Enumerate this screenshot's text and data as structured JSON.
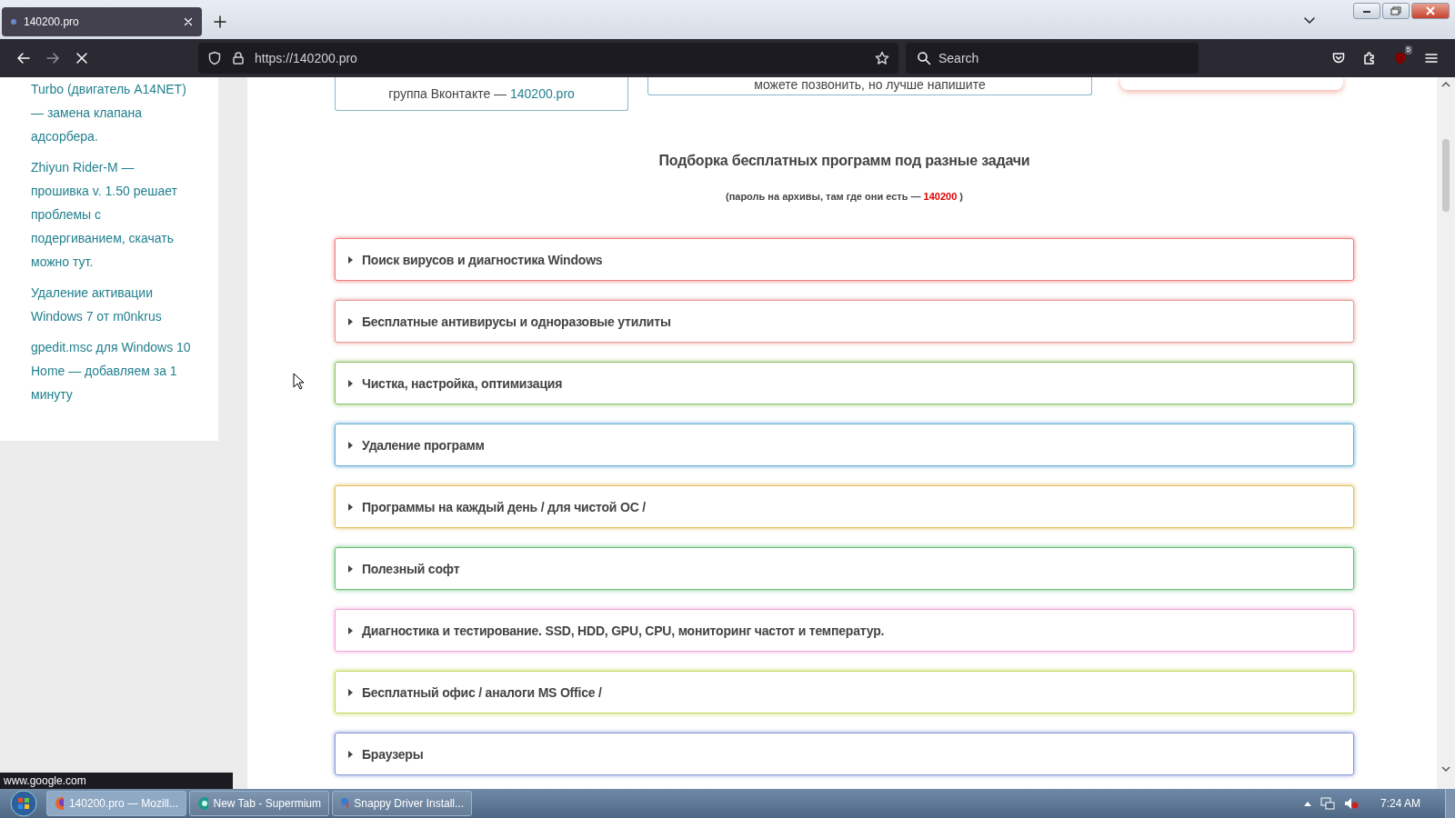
{
  "browser": {
    "tabs": [
      {
        "title": "140200.pro",
        "selected": true
      }
    ],
    "url": "https://140200.pro",
    "search_placeholder": "Search",
    "extensions_badge": "5"
  },
  "sidebar": {
    "links": [
      "Turbo (двигатель A14NET) — замена клапана адсорбера.",
      "Zhiyun Rider-M — прошивка v. 1.50 решает проблемы с подергиванием, скачать можно тут.",
      "Удаление активации Windows 7 от m0nkrus",
      "gpedit.msc для Windows 10 Home — добавляем за 1 минуту"
    ]
  },
  "cards": [
    {
      "text": "группа Вконтакте —",
      "link": "140200.pro"
    },
    {
      "text": "можете позвонить, но лучше напишите"
    }
  ],
  "heading": "Подборка бесплатных программ под разные задачи",
  "note": {
    "text": "(пароль на архивы, там где они есть —",
    "password": "140200",
    "closing": ")"
  },
  "sections": [
    {
      "title": "Поиск вирусов и диагностика Windows",
      "color": "#f08080",
      "expanded": false
    },
    {
      "title": "Бесплатные антивирусы и одноразовые утилиты",
      "color": "#e89a9a",
      "expanded": false
    },
    {
      "title": "Чистка, настройка, оптимизация",
      "color": "#8fc46a",
      "expanded": false
    },
    {
      "title": "Удаление программ",
      "color": "#6aaed6",
      "expanded": false
    },
    {
      "title": "Программы на каждый день / для чистой ОС /",
      "color": "#e0c060",
      "expanded": false
    },
    {
      "title": "Полезный софт",
      "color": "#6cc07a",
      "expanded": false
    },
    {
      "title": "Диагностика и тестирование. SSD, HDD, GPU, CPU, мониторинг частот и температур.",
      "color": "#f0a8d8",
      "expanded": false
    },
    {
      "title": "Бесплатный офис / аналоги MS Office /",
      "color": "#c8d860",
      "expanded": false
    },
    {
      "title": "Браузеры",
      "color": "#8a9ad8",
      "expanded": false
    }
  ],
  "status_url": "www.google.com",
  "taskbar": {
    "items": [
      {
        "label": "140200.pro — Mozill...",
        "kind": "firefox",
        "selected": true
      },
      {
        "label": "New Tab - Supermium",
        "kind": "supermium",
        "selected": false
      },
      {
        "label": "Snappy Driver Install...",
        "kind": "snappy",
        "selected": false
      }
    ],
    "clock": "7:24 AM"
  }
}
